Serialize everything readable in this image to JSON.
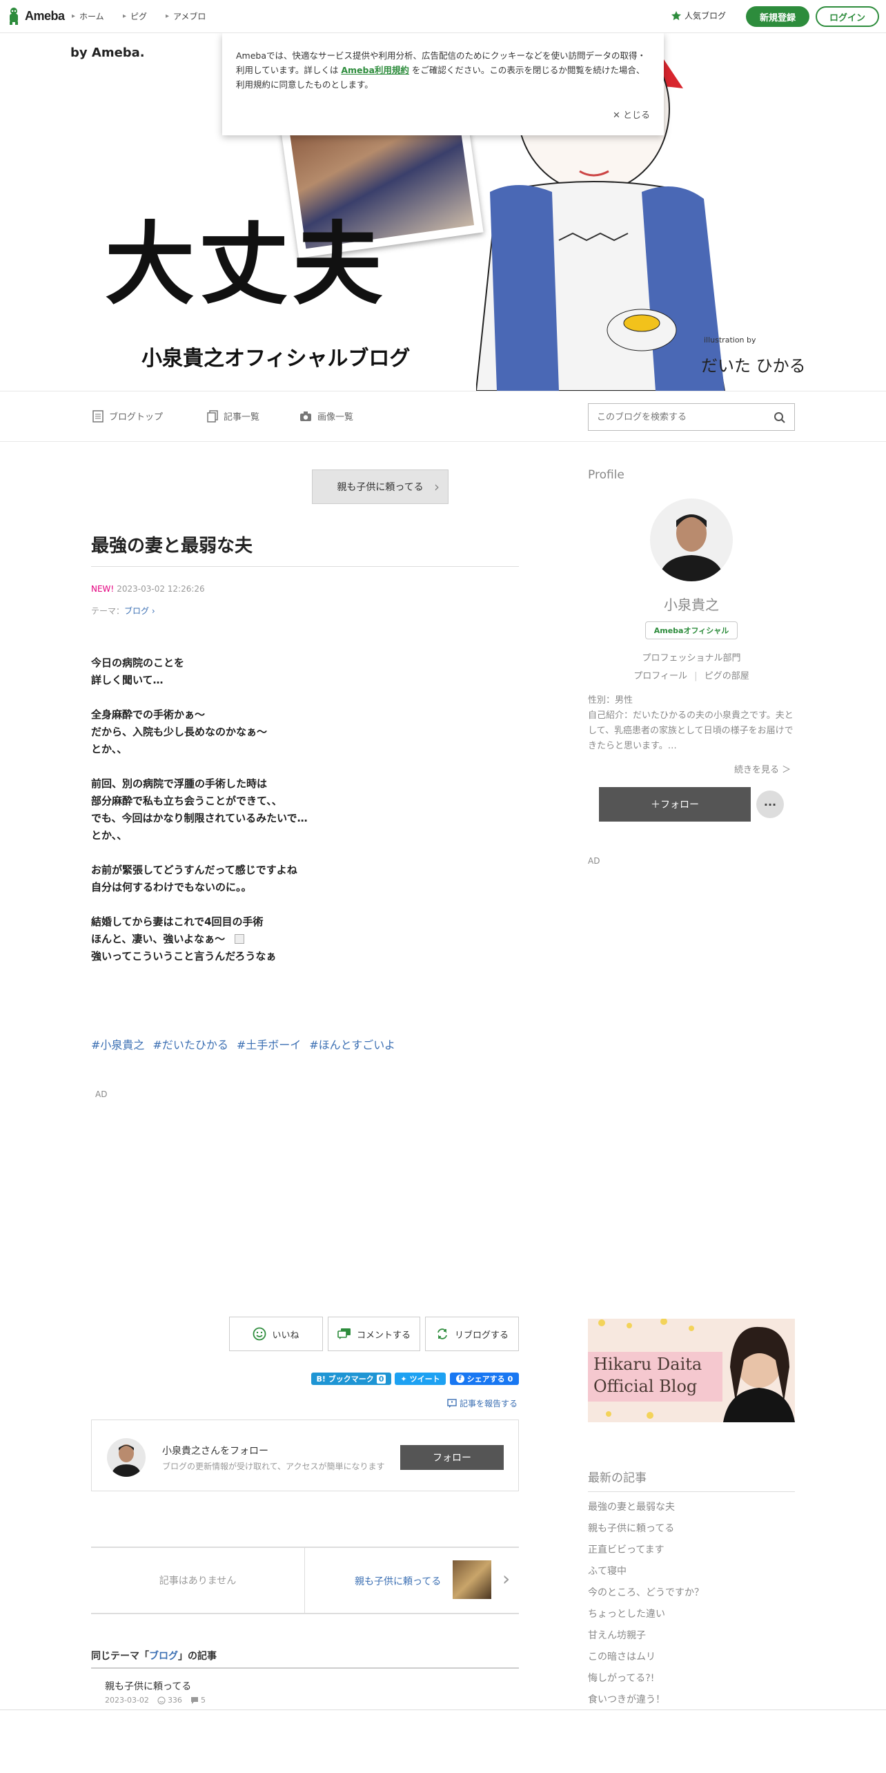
{
  "topnav": {
    "logo_text": "Ameba",
    "items": [
      "ホーム",
      "ピグ",
      "アメブロ"
    ],
    "popular_blog": "人気ブログ",
    "register": "新規登録",
    "login": "ログイン"
  },
  "cookie": {
    "text_before": "Amebaでは、快適なサービス提供や利用分析、広告配信のためにクッキーなどを使い訪問データの取得・利用しています。詳しくは ",
    "link": "Ameba利用規約",
    "text_after": " をご確認ください。この表示を閉じるか閲覧を続けた場合、利用規約に同意したものとします。",
    "close": "✕ とじる"
  },
  "header": {
    "by_ameba": "by Ameba.",
    "title_main": "大丈夫",
    "title_sub": "小泉貴之オフィシャルブログ",
    "illustration_by": "illustration by",
    "illustrator": "だいた ひかる"
  },
  "blogbar": {
    "top": "ブログトップ",
    "list": "記事一覧",
    "images": "画像一覧",
    "search_placeholder": "このブログを検索する"
  },
  "article": {
    "prev_top": "親も子供に頼ってる",
    "title": "最強の妻と最弱な夫",
    "new_label": "NEW!",
    "datetime": "2023-03-02 12:26:26",
    "theme_label": "テーマ：",
    "theme_value": "ブログ",
    "body": "今日の病院のことを\n詳しく聞いて…\n\n全身麻酔での手術かぁ〜\nだから、入院も少し長めなのかなぁ〜\nとか、、\n\n前回、別の病院で浮腫の手術した時は\n部分麻酔で私も立ち会うことができて、、\nでも、今回はかなり制限されているみたいで…\nとか、、\n\nお前が緊張してどうすんだって感じですよね\n自分は何するわけでもないのに。。\n\n結婚してから妻はこれで4回目の手術\nほんと、凄い、強いよなぁ〜\n強いってこういうこと言うんだろうなぁ",
    "hashtags": [
      "#小泉貴之",
      "#だいたひかる",
      "#土手ボーイ",
      "#ほんとすごいよ"
    ],
    "ad": "AD"
  },
  "actions": {
    "like": "いいね",
    "comment": "コメントする",
    "reblog": "リブログする",
    "hatena": "B! ブックマーク",
    "hatena_count": "0",
    "tweet": "ツイート",
    "fb_share": "シェアする",
    "fb_count": "0",
    "report": "記事を報告する"
  },
  "follow_box": {
    "title": "小泉貴之さんをフォロー",
    "desc": "ブログの更新情報が受け取れて、アクセスが簡単になります",
    "button": "フォロー"
  },
  "pager": {
    "none": "記事はありません",
    "next": "親も子供に頼ってる"
  },
  "same_theme": {
    "prefix": "同じテーマ「",
    "theme": "ブログ",
    "suffix": "」の記事",
    "item_title": "親も子供に頼ってる",
    "item_date": "2023-03-02",
    "likes": "336",
    "comments": "5"
  },
  "sidebar": {
    "profile_heading": "Profile",
    "name": "小泉貴之",
    "badge": "Amebaオフィシャル",
    "category": "プロフェッショナル部門",
    "link_profile": "プロフィール",
    "link_pig": "ピグの部屋",
    "gender": "性別：男性",
    "intro": "自己紹介：だいたひかるの夫の小泉貴之です。夫として、乳癌患者の家族として日頃の様子をお届けできたらと思います。…",
    "more": "続きを見る ＞",
    "follow": "＋フォロー",
    "more_dots": "···",
    "ad": "AD",
    "banner_line1": "Hikaru Daita",
    "banner_line2": "Official Blog",
    "latest_heading": "最新の記事",
    "latest": [
      "最強の妻と最弱な夫",
      "親も子供に頼ってる",
      "正直ビビってます",
      "ふて寝中",
      "今のところ、どうですか？",
      "ちょっとした違い",
      "甘えん坊親子",
      "この暗さはムリ",
      "悔しがってる?!",
      "食いつきが違う！"
    ]
  }
}
